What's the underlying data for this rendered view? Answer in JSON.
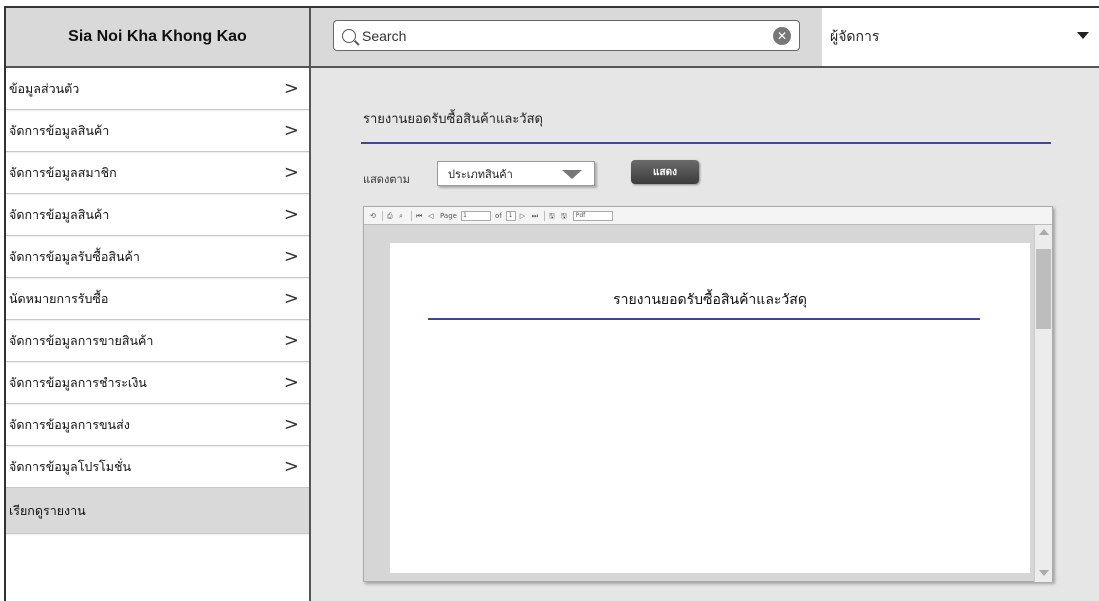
{
  "app": {
    "title": "Sia Noi Kha Khong Kao"
  },
  "sidebar": {
    "items": [
      {
        "label": "ข้อมูลส่วนตัว"
      },
      {
        "label": "จัดการข้อมูลสินค้า"
      },
      {
        "label": "จัดการข้อมูลสมาชิก"
      },
      {
        "label": "จัดการข้อมูลสินค้า"
      },
      {
        "label": "จัดการข้อมูลรับซื้อสินค้า"
      },
      {
        "label": "นัดหมายการรับซื้อ"
      },
      {
        "label": "จัดการข้อมูลการขายสินค้า"
      },
      {
        "label": "จัดการข้อมูลการชำระเงิน"
      },
      {
        "label": "จัดการข้อมูลการขนส่ง"
      },
      {
        "label": "จัดการข้อมูลโปรโมชั่น"
      }
    ],
    "active_item": {
      "label": "เรียกดูรายงาน"
    },
    "chevron": ">"
  },
  "search": {
    "placeholder": "Search",
    "value": ""
  },
  "role": {
    "label": "ผู้จัดการ"
  },
  "report": {
    "title": "รายงานยอดรับซื้อสินค้าและวัสดุ",
    "filter_label": "แสดงตาม",
    "filter_value": "ประเภทสินค้า",
    "show_button": "แสดง",
    "viewer": {
      "page_label": "Page",
      "page_value": "1",
      "of_label": "of",
      "total_pages": "1",
      "export_format": "Pdf",
      "paper_title": "รายงานยอดรับซื้อสินค้าและวัสดุ"
    }
  },
  "colors": {
    "accent_rule": "#3a4a8a",
    "header_bg": "#d9d9d9",
    "main_bg": "#e6e6e6"
  }
}
